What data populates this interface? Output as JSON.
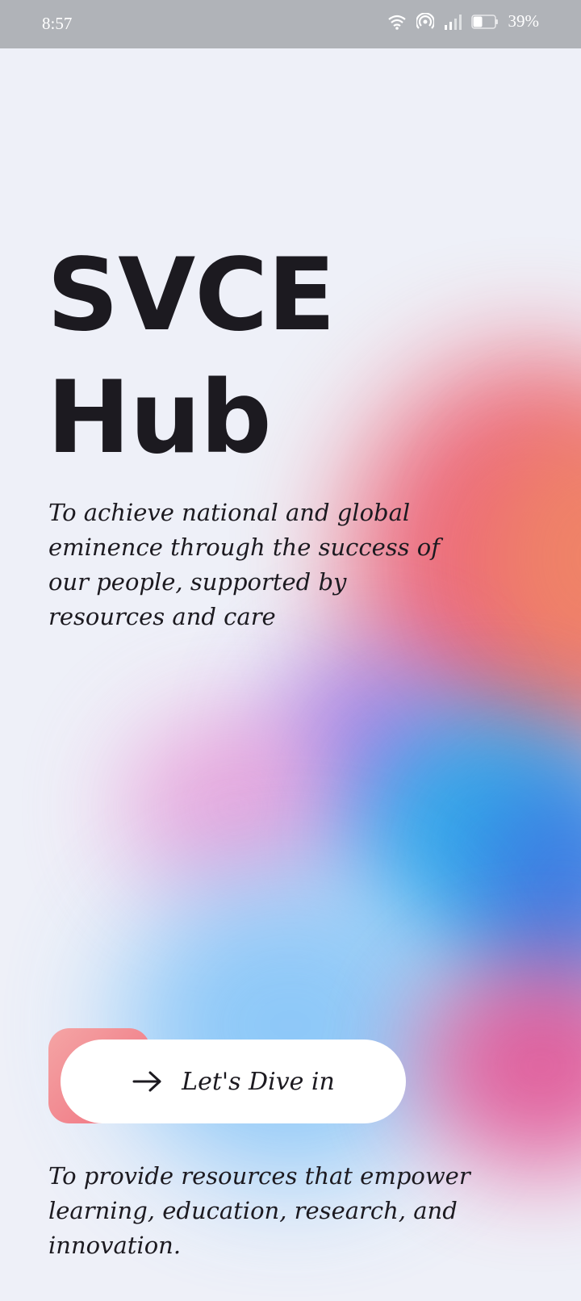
{
  "status_bar": {
    "time": "8:57",
    "battery_percent": "39%",
    "icons": [
      "wifi-icon",
      "hotspot-icon",
      "signal-icon",
      "battery-icon"
    ]
  },
  "hero": {
    "title_line1": "SVCE",
    "title_line2": "Hub",
    "vision_text": "To achieve national and global eminence through the success of our people, supported by resources and care"
  },
  "cta": {
    "label": "Let's Dive in",
    "icon": "arrow-right-icon"
  },
  "mission_text": "To provide resources that empower learning, education, research, and innovation.",
  "colors": {
    "background": "#eef0f8",
    "text": "#1c1a20",
    "status_bar": "#b0b3b8",
    "accent_red": "#ec5a6e",
    "accent_blue": "#1fa8ea",
    "accent_violet": "#a07ae6",
    "accent_magenta": "#e04a8e"
  }
}
